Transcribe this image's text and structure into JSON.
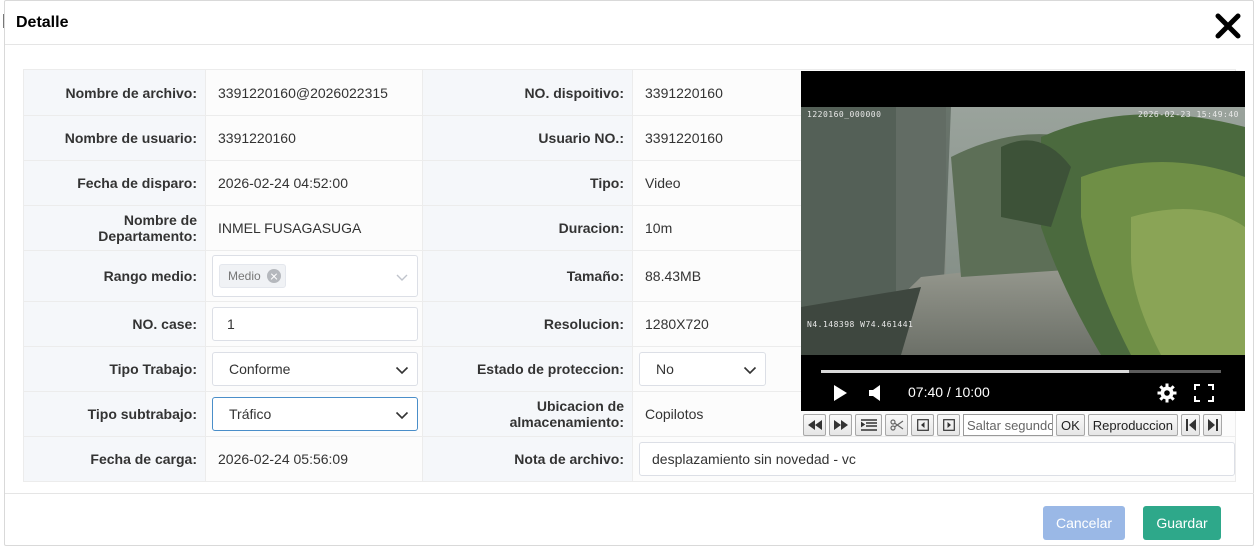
{
  "dialog": {
    "title": "Detalle"
  },
  "rows": [
    {
      "l1": "Nombre de archivo:",
      "v1": "3391220160@2026022315",
      "l2": "NO. dispoitivo:",
      "v2": "3391220160"
    },
    {
      "l1": "Nombre de usuario:",
      "v1": "3391220160",
      "l2": "Usuario NO.:",
      "v2": "3391220160"
    },
    {
      "l1": "Fecha de disparo:",
      "v1": "2026-02-24 04:52:00",
      "l2": "Tipo:",
      "v2": "Video"
    },
    {
      "l1": "Nombre de Departamento:",
      "v1": "INMEL FUSAGASUGA",
      "l2": "Duracion:",
      "v2": "10m"
    },
    {
      "l1": "Rango medio:",
      "v1": "Medio",
      "l2": "Tamaño:",
      "v2": "88.43MB"
    },
    {
      "l1": "NO. case:",
      "v1": "1",
      "l2": "Resolucion:",
      "v2": "1280X720"
    },
    {
      "l1": "Tipo Trabajo:",
      "v1": "Conforme",
      "l2": "Estado de proteccion:",
      "v2": "No"
    },
    {
      "l1": "Tipo subtrabajo:",
      "v1": "Tráfico",
      "l2": "Ubicacion de almacenamiento:",
      "v2": "Copilotos"
    },
    {
      "l1": "Fecha de carga:",
      "v1": "2026-02-24 05:56:09",
      "l2": "Nota de archivo:",
      "v2": "desplazamiento sin novedad - vc"
    }
  ],
  "player": {
    "osd_top_left": "1220160_000000",
    "osd_top_right": "2026-02-23  15:49:40",
    "osd_gps": "N4.148398  W74.461441",
    "time": "07:40 / 10:00",
    "progress_fraction": 0.77,
    "seek_placeholder": "Saltar segundos",
    "ok_label": "OK",
    "play_label": "Reproduccion"
  },
  "footer": {
    "cancel": "Cancelar",
    "save": "Guardar"
  },
  "colors": {
    "save": "#2ea88a",
    "cancel": "#9ab8e6",
    "label_bg": "#f5f7fa"
  },
  "icons": [
    "close-icon",
    "clear-tag-icon",
    "chevron-down-icon",
    "play-icon",
    "volume-icon",
    "settings-icon",
    "fullscreen-icon",
    "rewind-icon",
    "fast-forward-icon",
    "scissors-icon"
  ]
}
